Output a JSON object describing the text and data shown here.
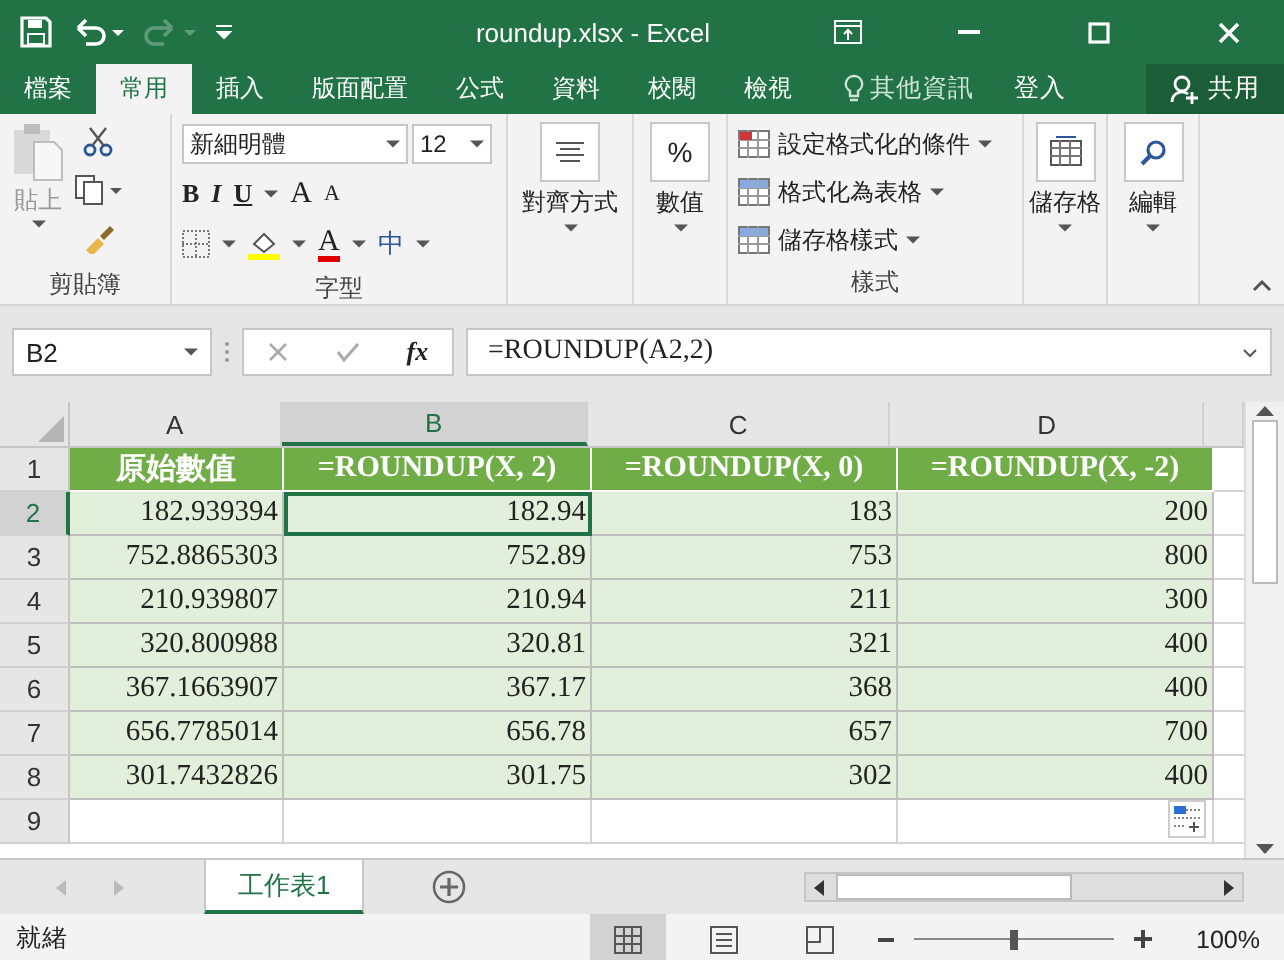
{
  "window": {
    "title": "roundup.xlsx - Excel"
  },
  "ribbon_tabs": [
    {
      "label": "檔案",
      "selected": false
    },
    {
      "label": "常用",
      "selected": true
    },
    {
      "label": "插入",
      "selected": false
    },
    {
      "label": "版面配置",
      "selected": false
    },
    {
      "label": "公式",
      "selected": false
    },
    {
      "label": "資料",
      "selected": false
    },
    {
      "label": "校閱",
      "selected": false
    },
    {
      "label": "檢視",
      "selected": false
    }
  ],
  "tell_me": "其他資訊",
  "sign_in": "登入",
  "share": "共用",
  "clipboard": {
    "paste": "貼上",
    "label": "剪貼簿"
  },
  "font": {
    "name": "新細明體",
    "size": "12",
    "bold": "B",
    "italic": "I",
    "underline": "U",
    "grow": "A",
    "shrink": "A",
    "color_glyph": "A",
    "phonetic": "中",
    "label": "字型"
  },
  "alignment": {
    "label": "對齊方式"
  },
  "number": {
    "glyph": "%",
    "label": "數值"
  },
  "styles": {
    "items": [
      "設定格式化的條件",
      "格式化為表格",
      "儲存格樣式"
    ],
    "label": "樣式"
  },
  "cells": {
    "label": "儲存格"
  },
  "editing": {
    "label": "編輯"
  },
  "name_box": "B2",
  "function_label": "fx",
  "formula": "=ROUNDUP(A2,2)",
  "columns": [
    {
      "label": "A",
      "selected": false
    },
    {
      "label": "B",
      "selected": true
    },
    {
      "label": "C",
      "selected": false
    },
    {
      "label": "D",
      "selected": false
    }
  ],
  "rows": [
    {
      "number": "1",
      "selected": false,
      "kind": "header",
      "cells": [
        "原始數值",
        "=ROUNDUP(X, 2)",
        "=ROUNDUP(X, 0)",
        "=ROUNDUP(X, -2)"
      ]
    },
    {
      "number": "2",
      "selected": true,
      "kind": "data",
      "cells": [
        "182.939394",
        "182.94",
        "183",
        "200"
      ]
    },
    {
      "number": "3",
      "selected": false,
      "kind": "data",
      "cells": [
        "752.8865303",
        "752.89",
        "753",
        "800"
      ]
    },
    {
      "number": "4",
      "selected": false,
      "kind": "data",
      "cells": [
        "210.939807",
        "210.94",
        "211",
        "300"
      ]
    },
    {
      "number": "5",
      "selected": false,
      "kind": "data",
      "cells": [
        "320.800988",
        "320.81",
        "321",
        "400"
      ]
    },
    {
      "number": "6",
      "selected": false,
      "kind": "data",
      "cells": [
        "367.1663907",
        "367.17",
        "368",
        "400"
      ]
    },
    {
      "number": "7",
      "selected": false,
      "kind": "data",
      "cells": [
        "656.7785014",
        "656.78",
        "657",
        "700"
      ]
    },
    {
      "number": "8",
      "selected": false,
      "kind": "data",
      "cells": [
        "301.7432826",
        "301.75",
        "302",
        "400"
      ]
    },
    {
      "number": "9",
      "selected": false,
      "kind": "empty",
      "cells": []
    }
  ],
  "sheet_tabs": [
    {
      "label": "工作表1",
      "selected": true
    }
  ],
  "status": "就緒",
  "zoom": {
    "level": 0.5,
    "reading": "100%"
  }
}
